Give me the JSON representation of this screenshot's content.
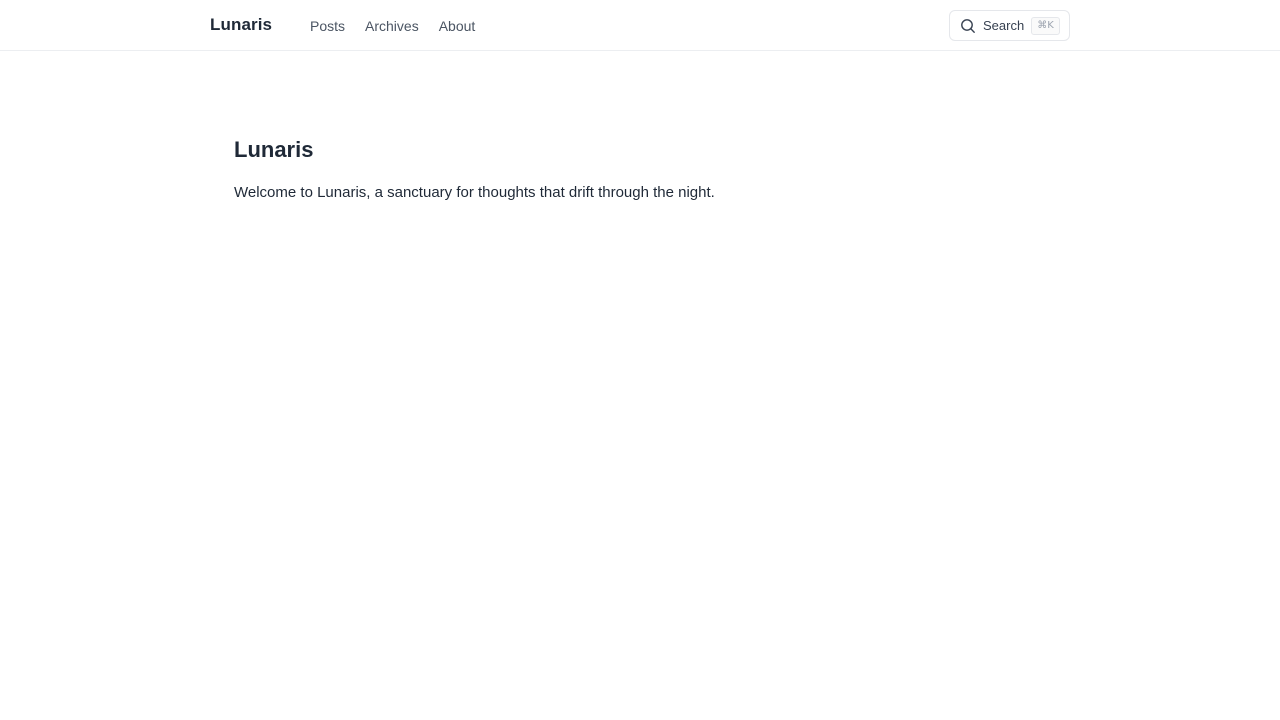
{
  "header": {
    "brand": "Lunaris",
    "nav": [
      {
        "label": "Posts"
      },
      {
        "label": "Archives"
      },
      {
        "label": "About"
      }
    ],
    "search": {
      "label": "Search",
      "shortcut": "⌘K",
      "icon": "search-icon"
    }
  },
  "main": {
    "title": "Lunaris",
    "intro": "Welcome to Lunaris, a sanctuary for thoughts that drift through the night."
  }
}
